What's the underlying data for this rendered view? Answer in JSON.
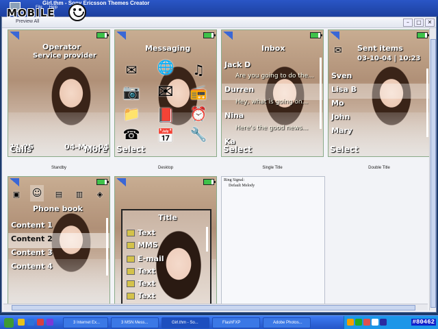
{
  "app": {
    "title": "Girl.thm - Sony Ericsson Themes Creator",
    "menu": [
      "File",
      "Help"
    ]
  },
  "window": {
    "title": "Preview All"
  },
  "watermark": "MOBILE",
  "phones": [
    {
      "caption": "Standby",
      "operator": "Operator",
      "provider": "Service provider",
      "time": "11:25",
      "date": "04-May-04",
      "left_soft": "Calls",
      "right_soft": "More"
    },
    {
      "caption": "Desktop",
      "title": "Messaging",
      "left_soft": "Select"
    },
    {
      "caption": "Single Title",
      "title": "Inbox",
      "left_soft": "Select",
      "items": [
        {
          "name": "Jack D",
          "msg": "Are you going to do the..."
        },
        {
          "name": "Durren",
          "msg": "Hey, what is going on..."
        },
        {
          "name": "Nina",
          "msg": "Here's the good news..."
        },
        {
          "name": "Ka",
          "msg": ""
        }
      ]
    },
    {
      "caption": "Double Title",
      "title": "Sent items",
      "datetime": "03-10-04 | 10:23",
      "left_soft": "Select",
      "items": [
        "Sven",
        "Lisa B",
        "Mo",
        "John",
        "Mary"
      ]
    },
    {
      "caption": "",
      "title": "Phone book",
      "items": [
        "Content 1",
        "Content 2",
        "Content 3",
        "Content 4"
      ]
    },
    {
      "caption": "",
      "popup_title": "Title",
      "popup_items": [
        "Text",
        "MMS",
        "E-mail",
        "Text",
        "Text",
        "Text"
      ]
    }
  ],
  "ring_signal": {
    "label": "Ring Signal:",
    "value": "Default Melody"
  },
  "taskbar": {
    "buttons": [
      "3 Internet Ex...",
      "3 MSN Mess...",
      "Girl.thm - So...",
      "FlashFXP",
      "Adobe Photos..."
    ],
    "clock": "#80462"
  },
  "colors": {
    "accent": "#2456c8",
    "battery": "#3fc24a",
    "signal": "#3a67d6"
  }
}
